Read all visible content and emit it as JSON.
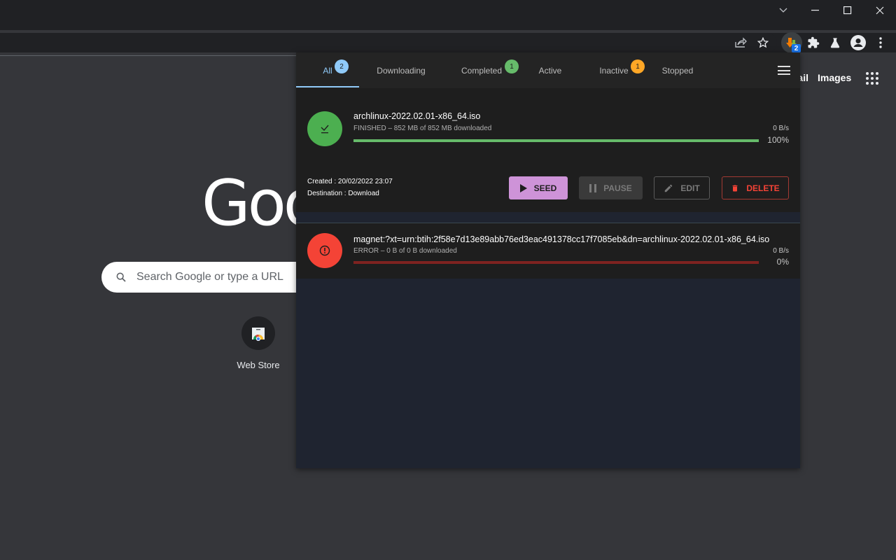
{
  "window": {
    "controls": {
      "dropdown": "chevron-down",
      "minimize": "minimize",
      "maximize": "maximize",
      "close": "close"
    }
  },
  "toolbar": {
    "extension_badge": "2"
  },
  "ntp": {
    "logo_text": "Google",
    "search_placeholder": "Search Google or type a URL",
    "shortcut_label": "Web Store",
    "links": {
      "gmail": "Gmail",
      "images": "Images"
    }
  },
  "popup": {
    "tabs": [
      {
        "label": "All",
        "badge": "2",
        "badge_color": "#90caf9",
        "active": true
      },
      {
        "label": "Downloading",
        "badge": null
      },
      {
        "label": "Completed",
        "badge": "1",
        "badge_color": "#66bb6a"
      },
      {
        "label": "Active",
        "badge": null
      },
      {
        "label": "Inactive",
        "badge": "1",
        "badge_color": "#ffa726"
      },
      {
        "label": "Stopped",
        "badge": null
      }
    ],
    "downloads": [
      {
        "name": "archlinux-2022.02.01-x86_64.iso",
        "status_line": "FINISHED – 852 MB of 852 MB downloaded",
        "speed": "0 B/s",
        "percent": "100%",
        "progress": 1.0,
        "status": "finished",
        "status_color": "#4caf50",
        "created": "Created : 20/02/2022 23:07",
        "destination": "Destination : Download",
        "buttons": {
          "seed": "SEED",
          "pause": "PAUSE",
          "edit": "EDIT",
          "delete": "DELETE"
        }
      },
      {
        "name": "magnet:?xt=urn:btih:2f58e7d13e89abb76ed3eac491378cc17f7085eb&dn=archlinux-2022.02.01-x86_64.iso",
        "status_line": "ERROR – 0 B of 0 B downloaded",
        "speed": "0 B/s",
        "percent": "0%",
        "progress": 0.0,
        "status": "error",
        "status_color": "#f44336"
      }
    ]
  }
}
